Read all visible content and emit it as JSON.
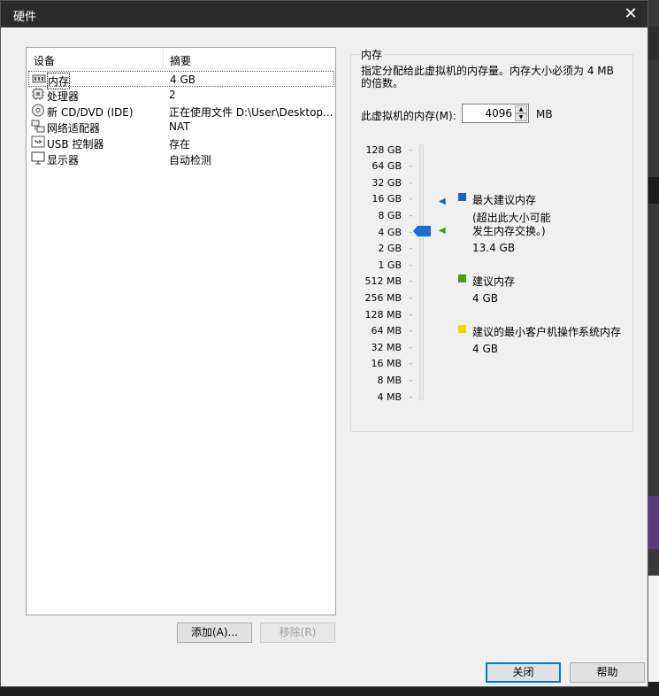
{
  "window": {
    "title": "硬件",
    "close_glyph": "✕"
  },
  "device_list": {
    "col_device": "设备",
    "col_summary": "摘要",
    "rows": [
      {
        "name": "内存",
        "summary": "4 GB",
        "icon": "memory-icon"
      },
      {
        "name": "处理器",
        "summary": "2",
        "icon": "cpu-icon"
      },
      {
        "name": "新 CD/DVD (IDE)",
        "summary": "正在使用文件 D:\\User\\Desktop...",
        "icon": "cd-dvd-icon"
      },
      {
        "name": "网络适配器",
        "summary": "NAT",
        "icon": "network-icon"
      },
      {
        "name": "USB 控制器",
        "summary": "存在",
        "icon": "usb-icon"
      },
      {
        "name": "显示器",
        "summary": "自动检测",
        "icon": "monitor-icon"
      }
    ],
    "selected_index": 0
  },
  "buttons": {
    "add": "添加(A)...",
    "remove": "移除(R)",
    "close": "关闭",
    "help": "帮助"
  },
  "memory": {
    "group_title": "内存",
    "description": "指定分配给此虚拟机的内存量。内存大小必须为 4 MB 的倍数。",
    "field_label": "此虚拟机的内存(M):",
    "value": "4096",
    "unit": "MB",
    "scale": [
      "128 GB",
      "64 GB",
      "32 GB",
      "16 GB",
      "8 GB",
      "4 GB",
      "2 GB",
      "1 GB",
      "512 MB",
      "256 MB",
      "128 MB",
      "64 MB",
      "32 MB",
      "16 MB",
      "8 MB",
      "4 MB"
    ],
    "current_level": "4 GB",
    "legend": {
      "max_title": "最大建议内存",
      "max_note1": "(超出此大小可能",
      "max_note2": "发生内存交换。)",
      "max_value": "13.4 GB",
      "rec_title": "建议内存",
      "rec_value": "4 GB",
      "min_title": "建议的最小客户机操作系统内存",
      "min_value": "4 GB"
    },
    "colors": {
      "max": "#1565c0",
      "rec": "#4a9a1e",
      "min": "#f5d400",
      "thumb": "#1a6fd1"
    }
  }
}
